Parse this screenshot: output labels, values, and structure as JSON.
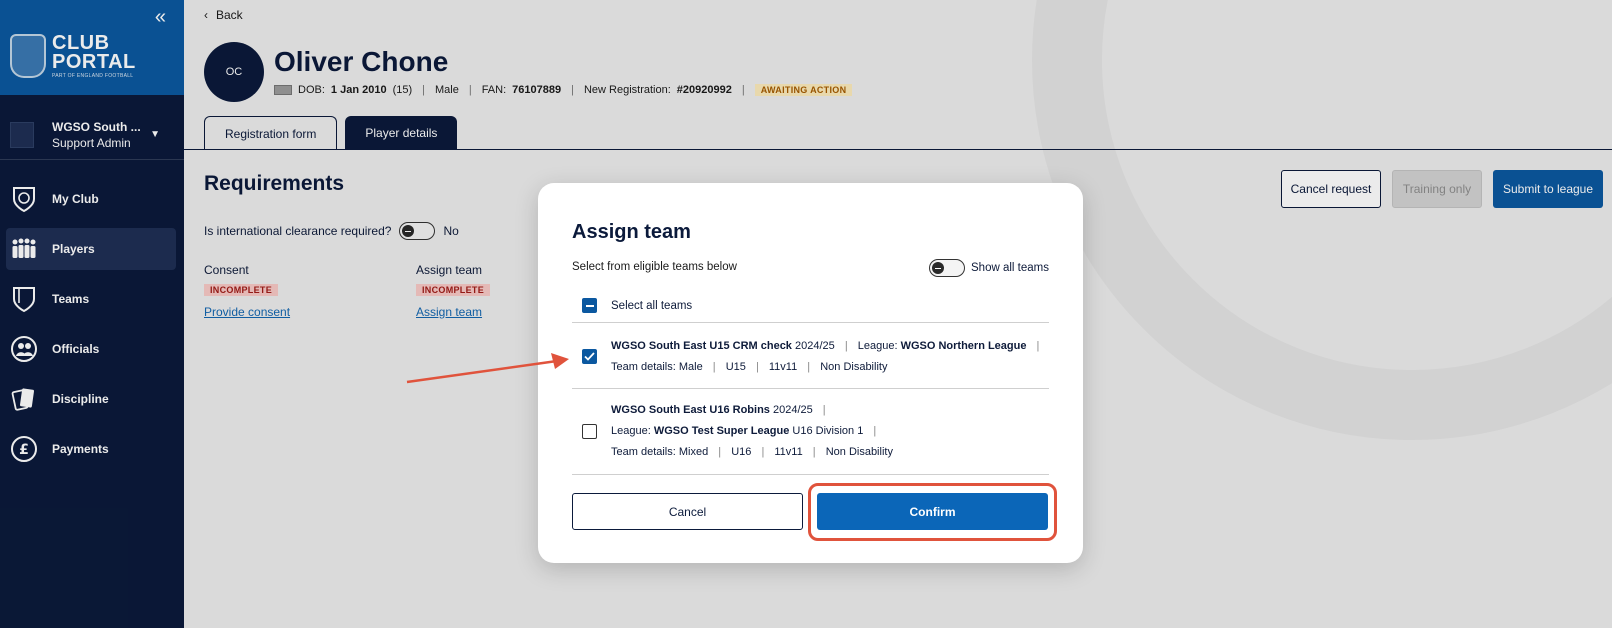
{
  "sidebar": {
    "logo": {
      "line1": "CLUB",
      "line2": "PORTAL",
      "tagline": "PART OF ENGLAND FOOTBALL"
    },
    "account": {
      "name": "WGSO South ...",
      "role": "Support Admin"
    },
    "items": [
      {
        "label": "My Club",
        "icon": "shield-ball-icon"
      },
      {
        "label": "Players",
        "icon": "players-icon",
        "active": true
      },
      {
        "label": "Teams",
        "icon": "shield-icon"
      },
      {
        "label": "Officials",
        "icon": "officials-icon"
      },
      {
        "label": "Discipline",
        "icon": "cards-icon"
      },
      {
        "label": "Payments",
        "icon": "pound-icon"
      }
    ]
  },
  "header": {
    "back": "Back",
    "avatar_initials": "OC",
    "player_name": "Oliver Chone",
    "dob_label": "DOB:",
    "dob_value": "1 Jan 2010",
    "age": "(15)",
    "gender": "Male",
    "fan_label": "FAN:",
    "fan_value": "76107889",
    "reg_label": "New Registration:",
    "reg_value": "#20920992",
    "status": "AWAITING ACTION"
  },
  "tabs": [
    {
      "label": "Registration form",
      "active": true
    },
    {
      "label": "Player details",
      "active": false
    }
  ],
  "requirements": {
    "title": "Requirements",
    "intl_question": "Is international clearance required?",
    "intl_value": "No",
    "consent_label": "Consent",
    "consent_status": "INCOMPLETE",
    "consent_link": "Provide consent",
    "assign_label": "Assign team",
    "assign_status": "INCOMPLETE",
    "assign_link": "Assign team"
  },
  "actions": {
    "cancel_request": "Cancel request",
    "training_only": "Training only",
    "submit": "Submit to league"
  },
  "modal": {
    "title": "Assign team",
    "subtitle": "Select from eligible teams below",
    "show_all_label": "Show all teams",
    "select_all_label": "Select all teams",
    "teams": [
      {
        "name": "WGSO South East U15 CRM check",
        "season": "2024/25",
        "league_label": "League:",
        "league": "WGSO Northern League",
        "division": "",
        "details_label": "Team details:",
        "gender": "Male",
        "age_group": "U15",
        "format": "11v11",
        "disability": "Non Disability",
        "checked": true
      },
      {
        "name": "WGSO South East U16 Robins",
        "season": "2024/25",
        "league_label": "League:",
        "league": "WGSO Test Super League",
        "division": "U16 Division 1",
        "details_label": "Team details:",
        "gender": "Mixed",
        "age_group": "U16",
        "format": "11v11",
        "disability": "Non Disability",
        "checked": false
      }
    ],
    "cancel": "Cancel",
    "confirm": "Confirm"
  },
  "colors": {
    "sidebar_bg": "#0b1a3b",
    "brand_blue": "#0b58a0",
    "highlight": "#e0533c",
    "awaiting_bg": "#fcebbb",
    "incomplete_bg": "#f8c9c6"
  }
}
